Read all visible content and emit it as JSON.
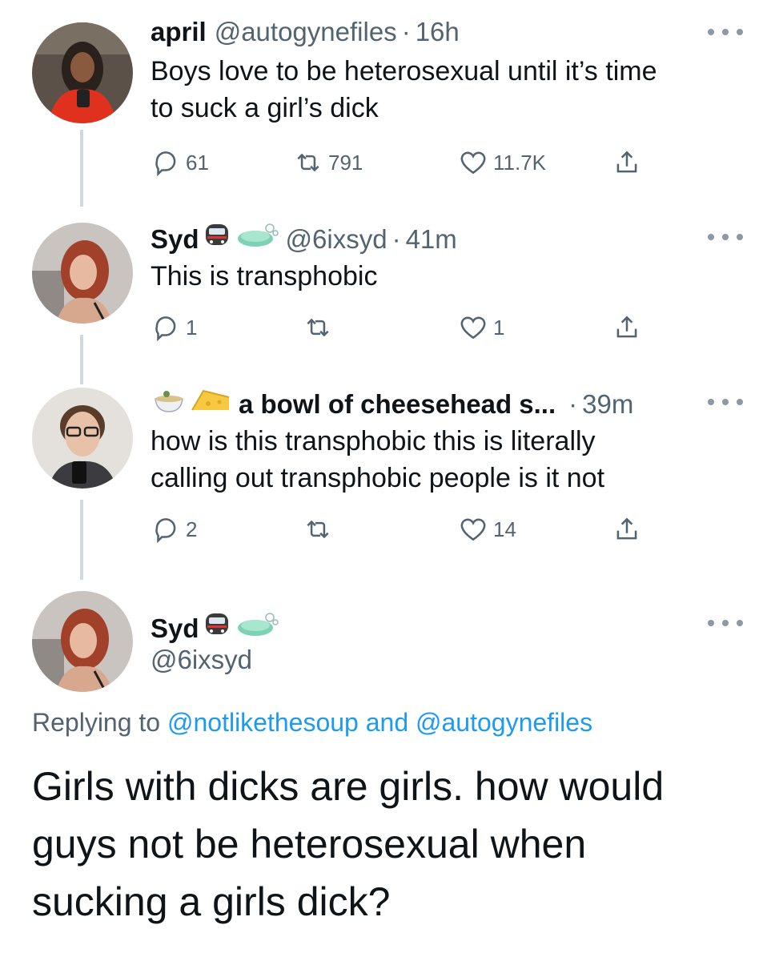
{
  "tweets": [
    {
      "name": "april",
      "handle": "@autogynefiles",
      "time": "16h",
      "text_lines": [
        "Boys love to be heterosexual until it’s time",
        "to suck a girl’s dick"
      ],
      "reply_count": "61",
      "retweet_count": "791",
      "like_count": "11.7K"
    },
    {
      "name": "Syd",
      "handle": "@6ixsyd",
      "time": "41m",
      "text_lines": [
        "This is transphobic"
      ],
      "reply_count": "1",
      "retweet_count": "",
      "like_count": "1"
    },
    {
      "name": "a bowl of cheesehead s...",
      "handle": "",
      "time": "39m",
      "text_lines": [
        "how is this transphobic this is literally",
        "calling out transphobic people is it not"
      ],
      "reply_count": "2",
      "retweet_count": "",
      "like_count": "14"
    }
  ],
  "main_tweet": {
    "name": "Syd",
    "handle": "@6ixsyd",
    "replying_prefix": "Replying to",
    "replying_mention_1": "@notlikethesoup",
    "replying_and": "and",
    "replying_mention_2": "@autogynefiles",
    "text_lines": [
      "Girls with dicks are girls. how would",
      "guys not be heterosexual when",
      "sucking a girls dick?"
    ]
  },
  "icons": {
    "reply": "speech-bubble-icon",
    "retweet": "retweet-icon",
    "like": "heart-icon",
    "share": "share-icon",
    "more": "more-dots-icon",
    "train": "train-emoji",
    "soap": "soap-emoji",
    "bowl": "bowl-emoji",
    "cheese": "cheese-emoji"
  },
  "colors": {
    "text": "#0f1419",
    "secondary": "#536471",
    "link": "#1d9bf0",
    "thread_line": "#cfd9de"
  }
}
